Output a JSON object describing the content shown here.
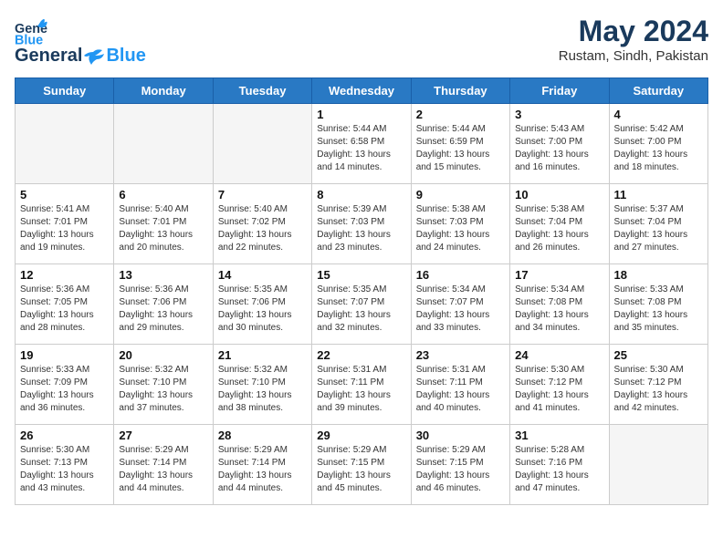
{
  "header": {
    "logo_line1": "General",
    "logo_line2": "Blue",
    "month_year": "May 2024",
    "location": "Rustam, Sindh, Pakistan"
  },
  "weekdays": [
    "Sunday",
    "Monday",
    "Tuesday",
    "Wednesday",
    "Thursday",
    "Friday",
    "Saturday"
  ],
  "weeks": [
    [
      {
        "day": "",
        "empty": true
      },
      {
        "day": "",
        "empty": true
      },
      {
        "day": "",
        "empty": true
      },
      {
        "day": "1",
        "sunrise": "5:44 AM",
        "sunset": "6:58 PM",
        "daylight": "13 hours and 14 minutes."
      },
      {
        "day": "2",
        "sunrise": "5:44 AM",
        "sunset": "6:59 PM",
        "daylight": "13 hours and 15 minutes."
      },
      {
        "day": "3",
        "sunrise": "5:43 AM",
        "sunset": "7:00 PM",
        "daylight": "13 hours and 16 minutes."
      },
      {
        "day": "4",
        "sunrise": "5:42 AM",
        "sunset": "7:00 PM",
        "daylight": "13 hours and 18 minutes."
      }
    ],
    [
      {
        "day": "5",
        "sunrise": "5:41 AM",
        "sunset": "7:01 PM",
        "daylight": "13 hours and 19 minutes."
      },
      {
        "day": "6",
        "sunrise": "5:40 AM",
        "sunset": "7:01 PM",
        "daylight": "13 hours and 20 minutes."
      },
      {
        "day": "7",
        "sunrise": "5:40 AM",
        "sunset": "7:02 PM",
        "daylight": "13 hours and 22 minutes."
      },
      {
        "day": "8",
        "sunrise": "5:39 AM",
        "sunset": "7:03 PM",
        "daylight": "13 hours and 23 minutes."
      },
      {
        "day": "9",
        "sunrise": "5:38 AM",
        "sunset": "7:03 PM",
        "daylight": "13 hours and 24 minutes."
      },
      {
        "day": "10",
        "sunrise": "5:38 AM",
        "sunset": "7:04 PM",
        "daylight": "13 hours and 26 minutes."
      },
      {
        "day": "11",
        "sunrise": "5:37 AM",
        "sunset": "7:04 PM",
        "daylight": "13 hours and 27 minutes."
      }
    ],
    [
      {
        "day": "12",
        "sunrise": "5:36 AM",
        "sunset": "7:05 PM",
        "daylight": "13 hours and 28 minutes."
      },
      {
        "day": "13",
        "sunrise": "5:36 AM",
        "sunset": "7:06 PM",
        "daylight": "13 hours and 29 minutes."
      },
      {
        "day": "14",
        "sunrise": "5:35 AM",
        "sunset": "7:06 PM",
        "daylight": "13 hours and 30 minutes."
      },
      {
        "day": "15",
        "sunrise": "5:35 AM",
        "sunset": "7:07 PM",
        "daylight": "13 hours and 32 minutes."
      },
      {
        "day": "16",
        "sunrise": "5:34 AM",
        "sunset": "7:07 PM",
        "daylight": "13 hours and 33 minutes."
      },
      {
        "day": "17",
        "sunrise": "5:34 AM",
        "sunset": "7:08 PM",
        "daylight": "13 hours and 34 minutes."
      },
      {
        "day": "18",
        "sunrise": "5:33 AM",
        "sunset": "7:08 PM",
        "daylight": "13 hours and 35 minutes."
      }
    ],
    [
      {
        "day": "19",
        "sunrise": "5:33 AM",
        "sunset": "7:09 PM",
        "daylight": "13 hours and 36 minutes."
      },
      {
        "day": "20",
        "sunrise": "5:32 AM",
        "sunset": "7:10 PM",
        "daylight": "13 hours and 37 minutes."
      },
      {
        "day": "21",
        "sunrise": "5:32 AM",
        "sunset": "7:10 PM",
        "daylight": "13 hours and 38 minutes."
      },
      {
        "day": "22",
        "sunrise": "5:31 AM",
        "sunset": "7:11 PM",
        "daylight": "13 hours and 39 minutes."
      },
      {
        "day": "23",
        "sunrise": "5:31 AM",
        "sunset": "7:11 PM",
        "daylight": "13 hours and 40 minutes."
      },
      {
        "day": "24",
        "sunrise": "5:30 AM",
        "sunset": "7:12 PM",
        "daylight": "13 hours and 41 minutes."
      },
      {
        "day": "25",
        "sunrise": "5:30 AM",
        "sunset": "7:12 PM",
        "daylight": "13 hours and 42 minutes."
      }
    ],
    [
      {
        "day": "26",
        "sunrise": "5:30 AM",
        "sunset": "7:13 PM",
        "daylight": "13 hours and 43 minutes."
      },
      {
        "day": "27",
        "sunrise": "5:29 AM",
        "sunset": "7:14 PM",
        "daylight": "13 hours and 44 minutes."
      },
      {
        "day": "28",
        "sunrise": "5:29 AM",
        "sunset": "7:14 PM",
        "daylight": "13 hours and 44 minutes."
      },
      {
        "day": "29",
        "sunrise": "5:29 AM",
        "sunset": "7:15 PM",
        "daylight": "13 hours and 45 minutes."
      },
      {
        "day": "30",
        "sunrise": "5:29 AM",
        "sunset": "7:15 PM",
        "daylight": "13 hours and 46 minutes."
      },
      {
        "day": "31",
        "sunrise": "5:28 AM",
        "sunset": "7:16 PM",
        "daylight": "13 hours and 47 minutes."
      },
      {
        "day": "",
        "empty": true
      }
    ]
  ],
  "labels": {
    "sunrise": "Sunrise:",
    "sunset": "Sunset:",
    "daylight": "Daylight hours"
  }
}
